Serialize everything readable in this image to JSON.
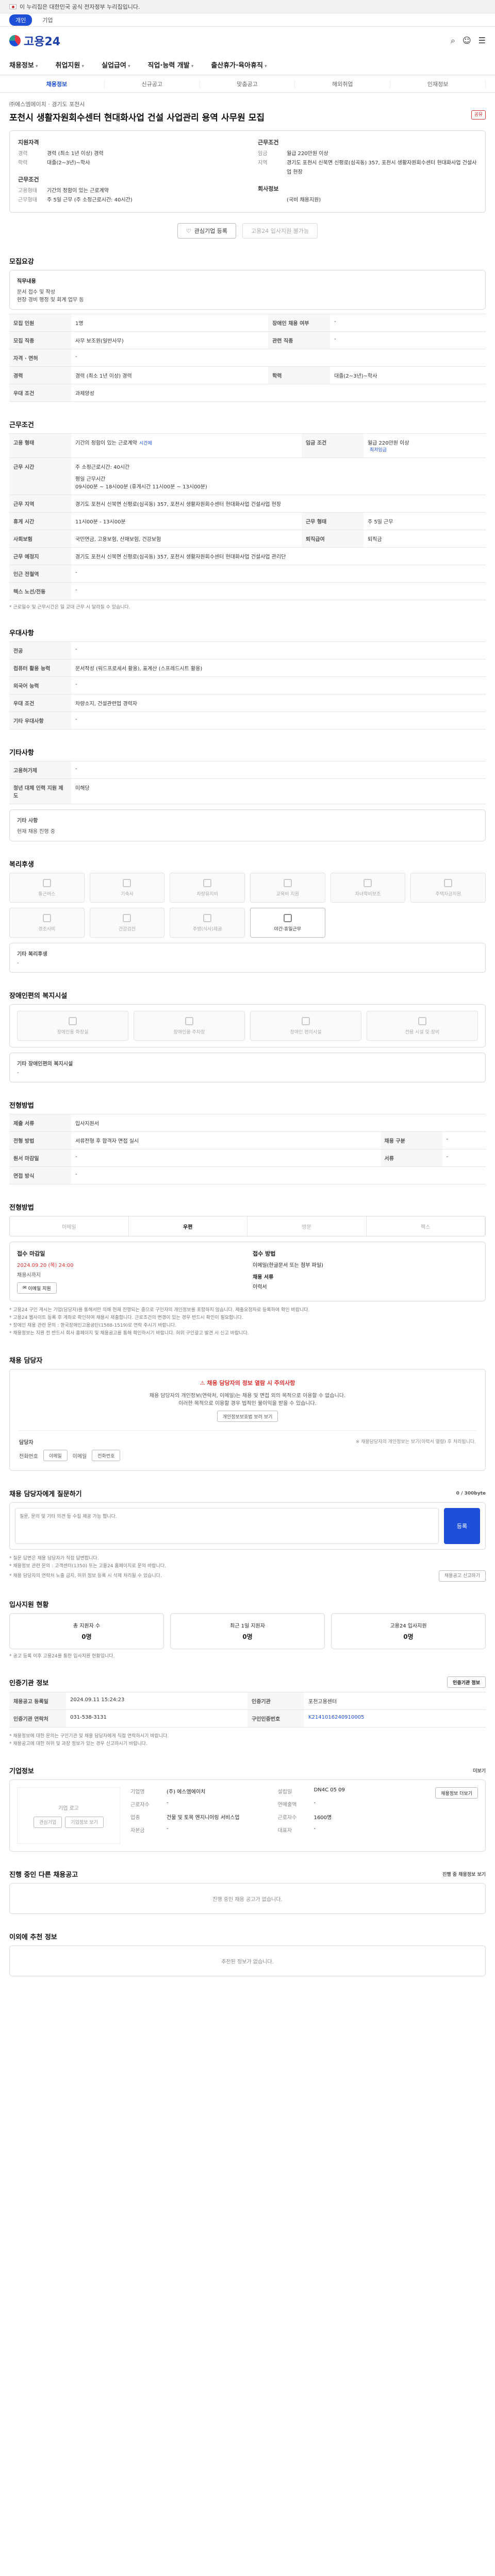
{
  "gov_bar": {
    "text": "이 누리집은 대한민국 공식 전자정부 누리집입니다."
  },
  "top_tabs": [
    "개인",
    "기업"
  ],
  "logo": {
    "text": "고용24"
  },
  "gnb": [
    "채용정보",
    "취업지원",
    "실업급여",
    "직업·능력 개발",
    "출산휴가·육아휴직"
  ],
  "subtabs": [
    "채용정보",
    "신규공고",
    "맞춤공고",
    "해외취업",
    "인재정보"
  ],
  "job": {
    "company_line": "㈜에스엠에이치 · 경기도 포천시",
    "title": "포천시 생활자원회수센터 현대화사업 건설 사업관리 용역 사무원 모집",
    "share_label": "공유"
  },
  "summary": {
    "left_title": "지원자격",
    "left": [
      {
        "k": "경력",
        "v": "경력 (최소 1년 이상) 경력"
      },
      {
        "k": "학력",
        "v": "대졸(2~3년)~학사"
      }
    ],
    "left2_title": "근무조건",
    "left2": [
      {
        "k": "고용형태",
        "v": "기간의 정함이 있는 근로계약"
      },
      {
        "k": "근무형태",
        "v": "주 5일 근무 (주 소정근로시간: 40시간)"
      }
    ],
    "right_title": "근무조건",
    "right": [
      {
        "k": "임금",
        "v": "월급 220만원 이상"
      },
      {
        "k": "지역",
        "v": "경기도 포천시 신북면 신평로(심곡동) 357, 포천시 생활자원회수센터 현대화사업 건설사업 현장"
      }
    ],
    "right2_title": "회사정보",
    "right2": [
      {
        "k": "",
        "v": "(국비 채용지원)"
      }
    ]
  },
  "buttons": {
    "interest": "관심기업 등록",
    "apply": "고용24 입사지원 불가능"
  },
  "recruit": {
    "title": "모집요강",
    "duties_h": "직무내용",
    "duties": "문서 접수 및 작성\n현장 경비 행정 및 회계 업무 등",
    "rows": [
      {
        "h": "모집 인원",
        "v": "1명",
        "h2": "장애인 채용 여부",
        "v2": "-"
      },
      {
        "h": "모집 직종",
        "v": "사무 보조원(일반사무)",
        "h2": "관련 직종",
        "v2": "-"
      },
      {
        "h": "자격 · 면허",
        "v": "-",
        "h2": "",
        "v2": ""
      },
      {
        "h": "경력",
        "v": "경력 (최소 1년 이상) 경력",
        "h2": "학력",
        "v2": "대졸(2~3년)~학사"
      },
      {
        "h": "우대 조건",
        "v": "과제양성",
        "h2": "",
        "v2": ""
      }
    ]
  },
  "conditions": {
    "title": "근무조건",
    "rows": [
      {
        "h": "고용 형태",
        "v": "기간의 정함이 있는 근로계약",
        "tag": "시간제",
        "h2": "임금 조건",
        "v2": "월급 220만원 이상",
        "tag2": "최저임금"
      },
      {
        "h": "근무 지역",
        "v": "경기도 포천시 신북면 신평로(심곡동) 357, 포천시 생활자원회수센터 현대화사업 건설사업 현장",
        "h2": "",
        "v2": ""
      },
      {
        "h": "휴게 시간",
        "v": "11시00분 - 13시00분",
        "h2": "근무 형태",
        "v2": "주 5일 근무"
      },
      {
        "h": "사회보험",
        "v": "국민연금, 고용보험, 산재보험, 건강보험",
        "h2": "퇴직급여",
        "v2": "퇴직금"
      },
      {
        "h": "근무 예정지",
        "v": "경기도 포천시 신북면 신평로(심곡동) 357, 포천시 생활자원회수센터 현대화사업 건설사업 관리단",
        "h2": "",
        "v2": ""
      },
      {
        "h": "인근 전철역",
        "v": "-",
        "h2": "",
        "v2": ""
      },
      {
        "h": "텍스 노선/전동",
        "v": "-",
        "h2": "",
        "v2": ""
      }
    ],
    "work_hours_label": "주 소정근로시간: 40시간",
    "work_time_label": "근무 시간",
    "work_time": "평일 근무시간\n09시00분 ~ 18시00분 (휴게시간 11시00분 ~ 13시00분)",
    "note": "* 근로일수 및 근무시간은 일 교대 근무 시 달라질 수 있습니다."
  },
  "benefits": {
    "title": "우대사항",
    "rows": [
      {
        "h": "전공",
        "v": "-"
      },
      {
        "h": "컴퓨터 활용 능력",
        "v": "문서작성 (워드프로세서 활용), 표계산 (스프레드시트 활용)"
      },
      {
        "h": "외국어 능력",
        "v": "-"
      },
      {
        "h": "우대 조건",
        "v": "차량소지, 건설관련업 경력자"
      },
      {
        "h": "기타 우대사항",
        "v": "-"
      }
    ]
  },
  "etc": {
    "title": "기타사항",
    "rows": [
      {
        "h": "고용허가제",
        "v": "-"
      },
      {
        "h": "청년 대체 인력 지원 제도",
        "v": "미해당"
      }
    ],
    "sub_h": "기타 사항",
    "sub_v": "현재 채용 진행 중"
  },
  "welfare": {
    "title": "복리후생",
    "items": [
      {
        "label": "통근버스",
        "on": false
      },
      {
        "label": "기숙사",
        "on": false
      },
      {
        "label": "차량유지비",
        "on": false
      },
      {
        "label": "교육비 지원",
        "on": false
      },
      {
        "label": "자녀학비보조",
        "on": false
      },
      {
        "label": "주택자금지원",
        "on": false
      },
      {
        "label": "경조사비",
        "on": false
      },
      {
        "label": "건강검진",
        "on": false
      },
      {
        "label": "주방(식사)제공",
        "on": false
      },
      {
        "label": "야간·휴일근무",
        "on": true
      }
    ],
    "etc_h": "기타 복리후생",
    "etc_v": "-"
  },
  "disabled_facility": {
    "title": "장애인편의 복지시설",
    "items": [
      "장애인용 화장실",
      "장애인용 주차장",
      "장애인 편의시설",
      "전용 시설 및 장비"
    ],
    "etc_h": "기타 장애인편의 복지시설",
    "etc_v": "-"
  },
  "selection": {
    "title": "전형방법",
    "rows": [
      {
        "h": "제출 서류",
        "v": "입사지원서"
      },
      {
        "h": "전형 방법",
        "v": "서류전형 후 합격자 면접 실시",
        "h2": "채용 구분",
        "v2": "-"
      },
      {
        "h": "원서 마감일",
        "v": "-",
        "h2": "서류",
        "v2": "-"
      },
      {
        "h": "면접 방식",
        "v": "-",
        "h2": "",
        "v2": ""
      }
    ]
  },
  "method": {
    "title": "전형방법",
    "tabs": [
      "이메일",
      "우편",
      "방문",
      "팩스"
    ],
    "deadline_h": "접수 마감일",
    "deadline": "2024.09.20 (목) 24:00",
    "deadline_note": "채용시까지",
    "email_label": "이메일 지원",
    "method_h": "접수 방법",
    "method_v": "이메일(한글문서 또는 첨부 파일)",
    "method2": "채용 서류",
    "method3": "이력서",
    "notices": [
      "* 고용24 구인 게시는 기업(담당자)를 통해서만 의해 현재 진행되는 중으로 구인자의 개인정보를 포함하지 않습니다. 제출요청자로 등록하여 확인 바랍니다.",
      "* 고용24 웹사이트 등록 후 계좌로 확인하여 채용시 제출합니다. 근로조건의 변경이 있는 경우 반드시 확인이 필요합니다.",
      "* 장애인 채용 관련 문의 : 한국장애인고용공단(1588-1519)로 연락 주시기 바랍니다.",
      "* 채용정보는 지원 전 반드시 회사 홈페이지 및 채용공고를 통해 확인하시기 바랍니다. 허위 구인광고 발견 시 신고 바랍니다."
    ]
  },
  "manager": {
    "title": "채용 담당자",
    "warn": "채용 담당자의 정보 열람 시 주의사항",
    "desc": "채용 담당자의 개인정보(연락처, 이메일)는 채용 및 면접 외의 목적으로 이용할 수 없습니다.",
    "desc2": "이러한 목적으로 이용할 경우 법적인 불이익을 받을 수 있습니다.",
    "btn": "개인정보보호법 보러 보기",
    "name_h": "담당자",
    "tel_h": "전화번호",
    "email_h": "이메일",
    "mail_chk": "이메일",
    "tel_chk": "전화번호",
    "privacy_note": "※ 채용담당자의 개인정보는 보기(이력서 열람) 후 처리됩니다."
  },
  "qa": {
    "title": "채용 담당자에게 질문하기",
    "placeholder": "질문, 문의 및 기타 의견 등 수집 제공 가능 합니다.",
    "count": "0 / 300byte",
    "submit": "등록",
    "notes": [
      "* 질문 답변은 채용 담당자가 직접 답변합니다.",
      "* 채용정보 관련 문의 : 고객센터(1350) 또는 고용24 홈페이지로 문의 바랍니다.",
      "* 채용 담당자의 연락처 노출 금지, 허위 정보 등록 시 삭제 처리될 수 있습니다."
    ],
    "report_btn": "채용공고 신고하기"
  },
  "applicant": {
    "title": "입사지원 현황",
    "items": [
      {
        "label": "총 지원자 수",
        "value": "0명"
      },
      {
        "label": "최근 1일 지원자",
        "value": "0명"
      },
      {
        "label": "고용24 입사지원",
        "value": "0명"
      }
    ],
    "note": "* 공고 등록 이후 고용24를 통한 입사지원 현황입니다."
  },
  "office": {
    "title": "인증기관 정보",
    "btn": "인증기관 정보",
    "rows": [
      {
        "h": "채용공고 등록일",
        "v": "2024.09.11 15:24:23",
        "h2": "인증기관",
        "v2": "포천고용센터"
      },
      {
        "h": "인증기관 연락처",
        "v": "031-538-3131",
        "h2": "구인인증번호",
        "v2": "K2141016240910005"
      }
    ],
    "notes": [
      "* 채용정보에 대한 문의는 구인기관 및 채용 담당자에게 직접 연락하시기 바랍니다.",
      "* 채용공고에 대한 허위 및 과장 정보가 있는 경우 신고하시기 바랍니다."
    ]
  },
  "company": {
    "title": "기업정보",
    "more": "더보기",
    "logo_alt": "기업 로고",
    "buttons": [
      "관심기업",
      "기업정보 보기"
    ],
    "name_h": "기업명",
    "name": "(주) 에스엠에이치",
    "emp_h": "근로자수",
    "emp": "-",
    "biz_h": "업종",
    "biz": "건물 및 토목 엔지니어링 서비스업",
    "cap_h": "자본금",
    "cap": "-",
    "date_h": "설립일",
    "date": "DN4C 05 09",
    "sales_h": "연매출액",
    "sales": "-",
    "rep_h": "대표자",
    "rep": "-",
    "staff_h": "근로자수",
    "staff": "1600명",
    "page_btn": "채용정보 더보기"
  },
  "other_jobs": {
    "title": "진행 중인 다른 채용공고",
    "link": "진행 중 채용정보 보기",
    "empty": "진행 중인 채용 공고가 없습니다."
  },
  "recommend": {
    "title": "이외에 추천 정보",
    "empty": "추천된 정보가 없습니다."
  }
}
